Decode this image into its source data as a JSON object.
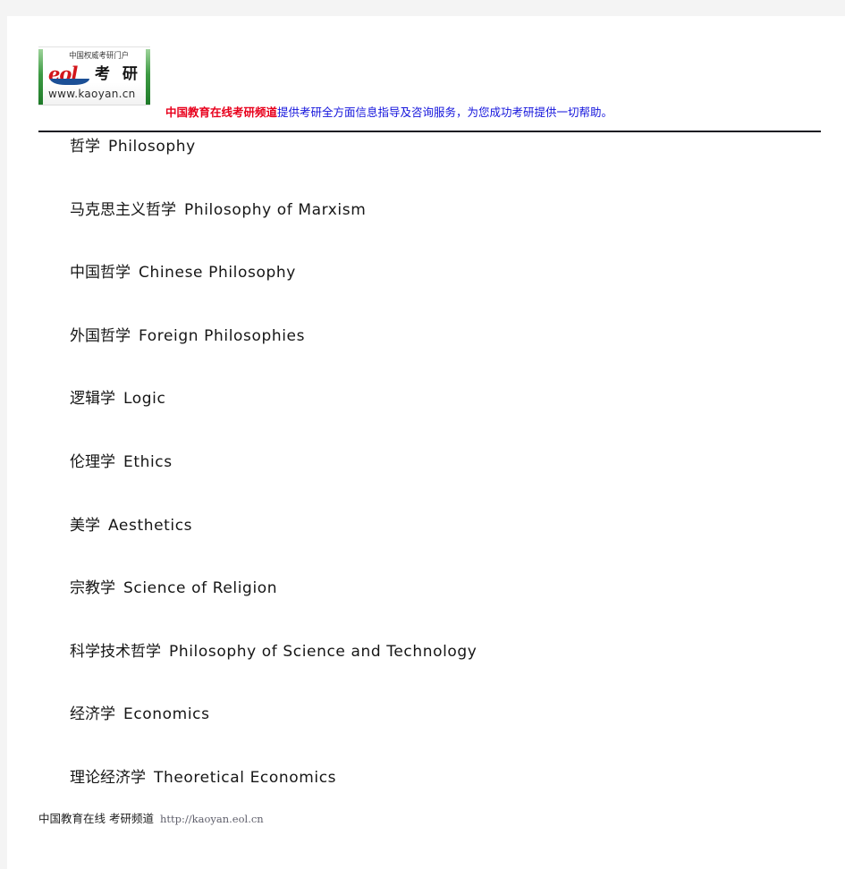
{
  "header": {
    "logo": {
      "tagline": "中国权威考研门户",
      "wordmark_en": "eol",
      "wordmark_cn": "考 研",
      "url": "www.kaoyan.cn"
    },
    "slogan_brand": "中国教育在线考研频道",
    "slogan_text": "提供考研全方面信息指导及咨询服务，为您成功考研提供一切帮助。"
  },
  "subjects": [
    {
      "cn": "哲学",
      "en": "Philosophy"
    },
    {
      "cn": "马克思主义哲学",
      "en": "Philosophy of Marxism"
    },
    {
      "cn": "中国哲学",
      "en": "Chinese Philosophy"
    },
    {
      "cn": "外国哲学",
      "en": "Foreign Philosophies"
    },
    {
      "cn": "逻辑学",
      "en": "Logic"
    },
    {
      "cn": "伦理学",
      "en": "Ethics"
    },
    {
      "cn": "美学",
      "en": "Aesthetics"
    },
    {
      "cn": "宗教学",
      "en": "Science of Religion"
    },
    {
      "cn": "科学技术哲学",
      "en": "Philosophy of Science and Technology"
    },
    {
      "cn": "经济学",
      "en": "Economics"
    },
    {
      "cn": "理论经济学",
      "en": "Theoretical Economics"
    }
  ],
  "footer": {
    "brand": "中国教育在线 考研频道",
    "url": "http://kaoyan.eol.cn"
  },
  "colors": {
    "page_background": "#f4f4f4",
    "sheet": "#ffffff",
    "slogan_brand": "#e8001c",
    "slogan_text": "#1414dc",
    "rule": "#1a1a22",
    "logo_green": "#3e9b44",
    "logo_red": "#d3161b",
    "footer_url": "#5f5f6b"
  }
}
